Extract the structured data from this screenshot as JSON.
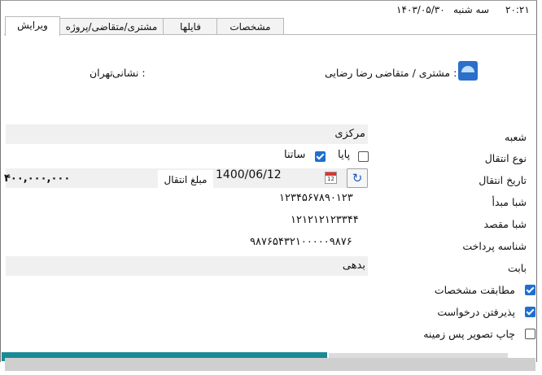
{
  "topbar": {
    "time": "۲۰:۲۱",
    "day": "سه شنبه",
    "date": "۱۴۰۳/۰۵/۳۰"
  },
  "tabs": [
    "ویرایش",
    "مشتری/متقاضی/پروژه",
    "فایلها",
    "مشخصات"
  ],
  "header": {
    "customer_label": "مشتری / متقاضی :",
    "customer_value": "رضا رضایی",
    "address_label": "نشانی :",
    "address_value": "تهران"
  },
  "form": {
    "branch_label": "شعبه",
    "branch_value": "مرکزی",
    "transfer_type_label": "نوع انتقال",
    "type_satna": "ساتنا",
    "type_paya": "پایا",
    "transfer_date_label": "تاریخ انتقال",
    "transfer_date_value": "1400/06/12",
    "calendar_day": "12",
    "amount_label": "مبلغ انتقال",
    "amount_value": "۴۰۰,۰۰۰,۰۰۰",
    "sheba_source_label": "شبا مبدأ",
    "sheba_source_value": "۱۲۳۴۵۶۷۸۹۰۱۲۳",
    "sheba_dest_label": "شبا مقصد",
    "sheba_dest_value": "۱۲۱۲۱۲۱۲۳۳۴۴",
    "payment_id_label": "شناسه پرداخت",
    "payment_id_value": "۹۸۷۶۵۴۳۲۱۰۰۰۰۰۹۸۷۶",
    "reason_label": "بابت",
    "reason_value": "بدهی"
  },
  "checks": {
    "match_label": "مطابقت مشخصات",
    "accept_label": "پذیرفتن درخواست",
    "print_label": "چاپ تصویر پس زمینه"
  },
  "colors": {
    "accent": "#1f6fd1",
    "teal": "#1b8a97"
  }
}
